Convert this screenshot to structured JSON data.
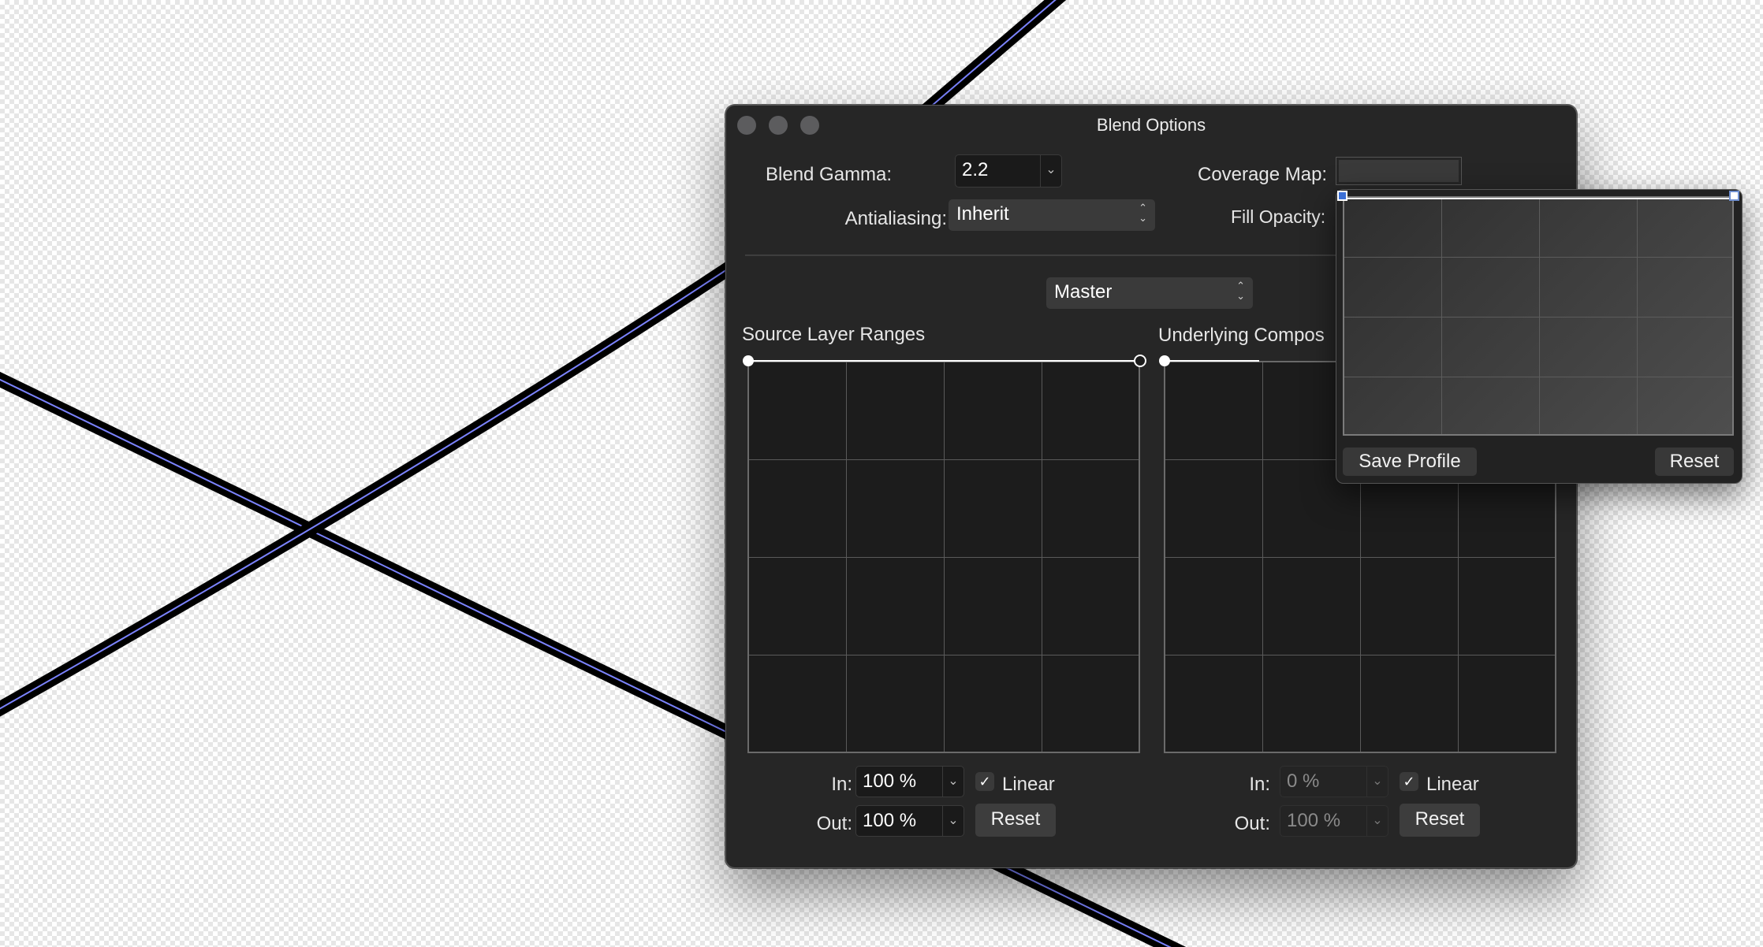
{
  "window": {
    "title": "Blend Options"
  },
  "top_controls": {
    "blend_gamma_label": "Blend Gamma:",
    "blend_gamma_value": "2.2",
    "antialiasing_label": "Antialiasing:",
    "antialiasing_value": "Inherit",
    "coverage_map_label": "Coverage Map:",
    "fill_opacity_label": "Fill Opacity:"
  },
  "channel_select": {
    "value": "Master"
  },
  "source_panel": {
    "title": "Source Layer Ranges",
    "in_label": "In:",
    "in_value": "100 %",
    "out_label": "Out:",
    "out_value": "100 %",
    "linear_label": "Linear",
    "linear_checked": true,
    "reset_label": "Reset"
  },
  "underlying_panel": {
    "title": "Underlying Compos",
    "in_label": "In:",
    "in_value": "0 %",
    "out_label": "Out:",
    "out_value": "100 %",
    "linear_label": "Linear",
    "linear_checked": true,
    "reset_label": "Reset"
  },
  "coverage_popover": {
    "save_profile_label": "Save Profile",
    "reset_label": "Reset"
  },
  "icons": {
    "checkmark": "✓",
    "chevron": "⌄",
    "updown": "⌃⌄"
  },
  "colors": {
    "window_bg": "#262626",
    "curve_line": "#ffffff",
    "handle_accent": "#3b6fd6",
    "canvas_stroke": "#000000",
    "canvas_inner_stroke": "#7b83ff"
  }
}
